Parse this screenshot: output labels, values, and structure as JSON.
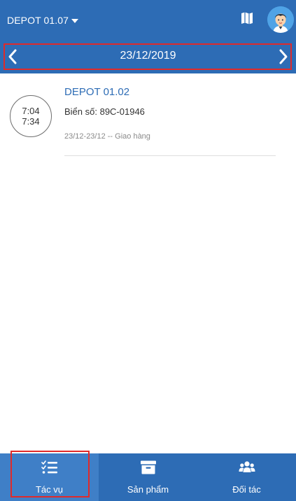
{
  "header": {
    "depot": "DEPOT 01.07"
  },
  "date_nav": {
    "date": "23/12/2019"
  },
  "tasks": [
    {
      "time_start": "7:04",
      "time_end": "7:34",
      "title": "DEPOT 01.02",
      "plate": "Biển số: 89C-01946",
      "meta": "23/12-23/12 --  Giao hàng"
    }
  ],
  "bottom_nav": {
    "tabs": [
      {
        "label": "Tác vụ",
        "icon": "task-list-icon",
        "active": true
      },
      {
        "label": "Sản phẩm",
        "icon": "archive-box-icon",
        "active": false
      },
      {
        "label": "Đối tác",
        "icon": "users-icon",
        "active": false
      }
    ]
  },
  "colors": {
    "primary": "#2d6cb5",
    "active_tab": "#3f7fc7",
    "highlight": "#e02a2a"
  }
}
